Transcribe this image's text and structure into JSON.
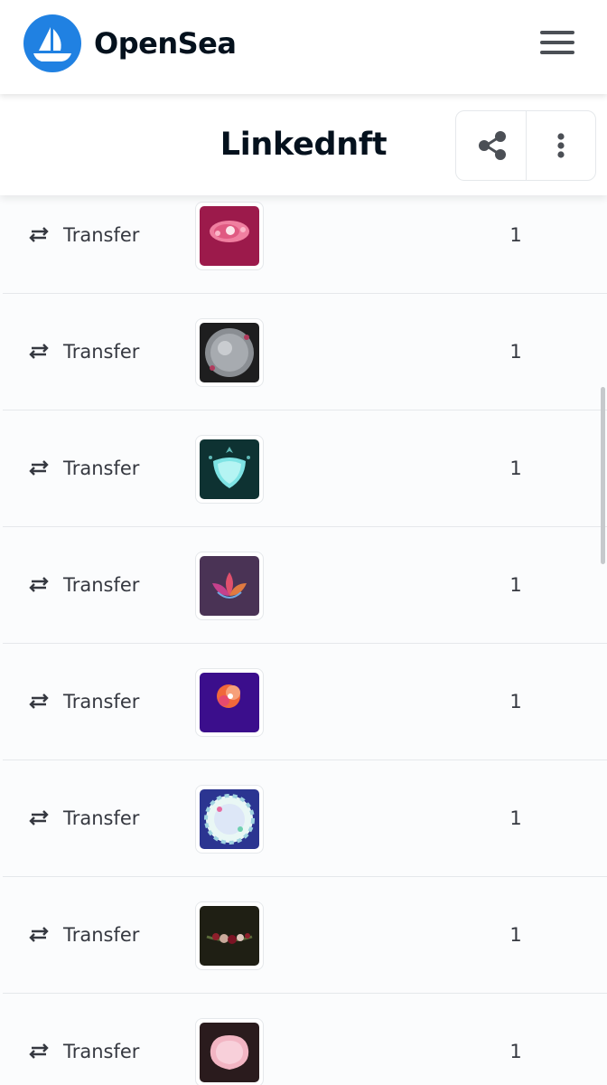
{
  "nav": {
    "brand": "OpenSea",
    "logo_icon": "opensea-ship-icon",
    "menu_icon": "hamburger-menu-icon"
  },
  "collection": {
    "title": "Linkednft",
    "share_icon": "share-icon",
    "more_icon": "more-vertical-icon"
  },
  "activity": {
    "rows": [
      {
        "event_icon": "transfer-arrows-icon",
        "event": "Transfer",
        "thumbnail": "pink-floral-frame",
        "quantity": "1"
      },
      {
        "event_icon": "transfer-arrows-icon",
        "event": "Transfer",
        "thumbnail": "grey-round-frame",
        "quantity": "1"
      },
      {
        "event_icon": "transfer-arrows-icon",
        "event": "Transfer",
        "thumbnail": "teal-shield",
        "quantity": "1"
      },
      {
        "event_icon": "transfer-arrows-icon",
        "event": "Transfer",
        "thumbnail": "lotus-on-purple",
        "quantity": "1"
      },
      {
        "event_icon": "transfer-arrows-icon",
        "event": "Transfer",
        "thumbnail": "orange-splash-on-violet",
        "quantity": "1"
      },
      {
        "event_icon": "transfer-arrows-icon",
        "event": "Transfer",
        "thumbnail": "feather-circle-on-blue",
        "quantity": "1"
      },
      {
        "event_icon": "transfer-arrows-icon",
        "event": "Transfer",
        "thumbnail": "roses-on-dark",
        "quantity": "1"
      },
      {
        "event_icon": "transfer-arrows-icon",
        "event": "Transfer",
        "thumbnail": "pink-frame-on-dark",
        "quantity": "1"
      }
    ]
  },
  "colors": {
    "brand_blue": "#2081e2",
    "text_dark": "#04111d",
    "text_body": "#353840",
    "border": "#e5e8eb"
  }
}
